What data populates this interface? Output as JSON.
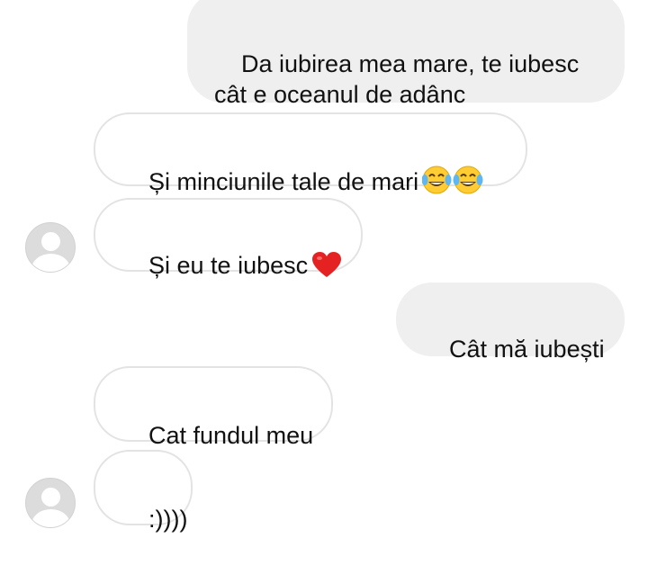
{
  "conversation": {
    "messages": [
      {
        "sender": "me",
        "text": "Da iubirea mea mare, te iubesc\ncât e oceanul de adânc"
      },
      {
        "sender": "them",
        "text": "Și minciunile tale de mari",
        "emoji": "laughing-tears-emoji x2"
      },
      {
        "sender": "them",
        "text": "Și eu te iubesc",
        "emoji": "red-heart-emoji"
      },
      {
        "sender": "me",
        "text": "Cât mă iubești"
      },
      {
        "sender": "them",
        "text": "Cat fundul meu"
      },
      {
        "sender": "them",
        "text": ":))))"
      }
    ]
  },
  "colors": {
    "outgoing_bubble": "#efefef",
    "incoming_border": "#e3e3e3",
    "avatar": "#dcdcdc"
  }
}
